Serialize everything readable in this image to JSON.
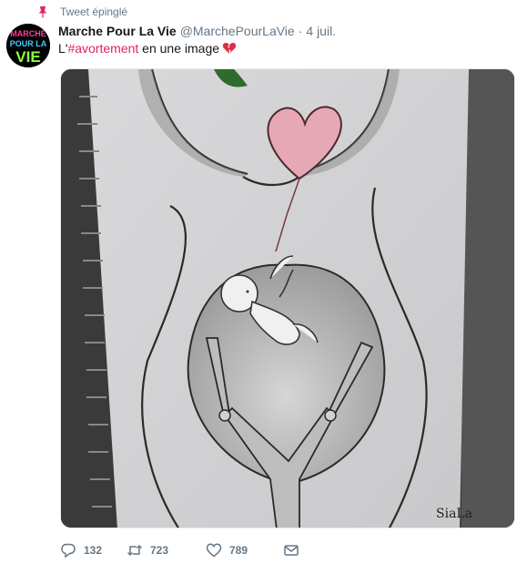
{
  "pinned": {
    "label": "Tweet épinglé"
  },
  "avatar": {
    "logo_text": "MARCHE POUR LA VIE"
  },
  "tweet": {
    "display_name": "Marche Pour La Vie",
    "handle": "@MarchePourLaVie",
    "separator": "·",
    "timestamp": "4 juil.",
    "text_prefix": "L'",
    "hashtag": "#avortement",
    "text_suffix": " en une image",
    "emoji": "broken-heart-icon"
  },
  "media": {
    "signature": "SiaLa"
  },
  "actions": {
    "replies": "132",
    "retweets": "723",
    "likes": "789"
  },
  "colors": {
    "hashtag": "#e0245e",
    "secondary_text": "#657786",
    "pin": "#e0245e"
  }
}
